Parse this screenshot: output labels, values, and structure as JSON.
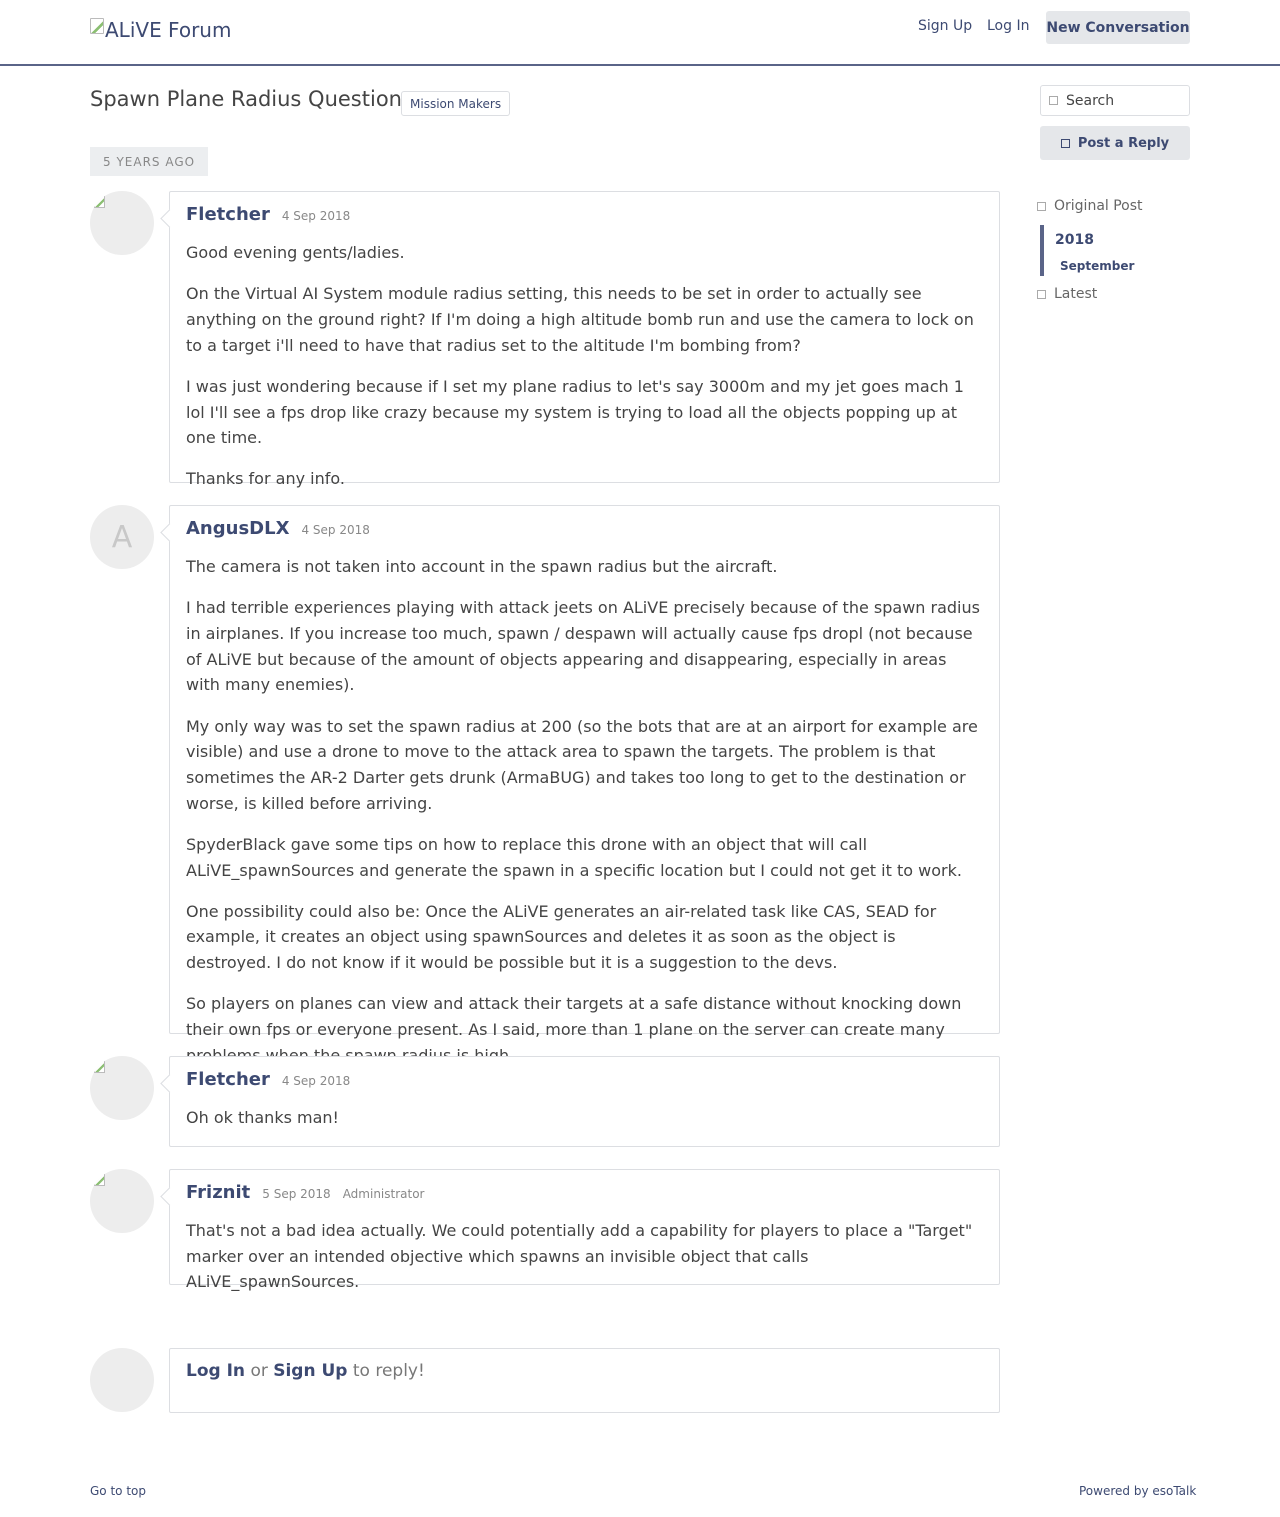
{
  "header": {
    "logo_alt": "ALiVE Forum",
    "sign_up": "Sign Up",
    "log_in": "Log In",
    "new_conversation": "New Conversation"
  },
  "conversation": {
    "title": "Spawn Plane Radius Question",
    "channel": "Mission Makers",
    "time_marker": "5 YEARS AGO"
  },
  "sidebar": {
    "search_placeholder": "Search",
    "post_reply": "Post a Reply",
    "scrubber": {
      "original_post": "Original Post",
      "year": "2018",
      "month": "September",
      "latest": "Latest"
    }
  },
  "posts": [
    {
      "author": "Fletcher",
      "date": "4 Sep 2018",
      "avatar": "broken-image",
      "paragraphs": [
        "Good evening gents/ladies.",
        "On the Virtual AI System module radius setting, this needs to be set in order to actually see anything on the ground right? If I'm doing a high altitude bomb run and use the camera to lock on to a target i'll need to have that radius set to the altitude I'm bombing from?",
        "I was just wondering because if I set my plane radius to let's say 3000m and my jet goes mach 1 lol I'll see a fps drop like crazy because my system is trying to load all the objects popping up at one time.",
        "Thanks for any info."
      ]
    },
    {
      "author": "AngusDLX",
      "date": "4 Sep 2018",
      "avatar_letter": "A",
      "paragraphs": [
        "The camera is not taken into account in the spawn radius but the aircraft.",
        "I had terrible experiences playing with attack jeets on ALiVE precisely because of the spawn radius in airplanes. If you increase too much, spawn / despawn will actually cause fps dropl (not because of ALiVE but because of the amount of objects appearing and disappearing, especially in areas with many enemies).",
        "My only way was to set the spawn radius at 200 (so the bots that are at an airport for example are visible) and use a drone to move to the attack area to spawn the targets. The problem is that sometimes the AR-2 Darter gets drunk (ArmaBUG) and takes too long to get to the destination or worse, is killed before arriving.",
        "SpyderBlack gave some tips on how to replace this drone with an object that will call ALiVE_spawnSources and generate the spawn in a specific location but I could not get it to work.",
        "One possibility could also be: Once the ALiVE generates an air-related task like CAS, SEAD for example, it creates an object using spawnSources and deletes it as soon as the object is destroyed. I do not know if it would be possible but it is a suggestion to the devs.",
        "So players on planes can view and attack their targets at a safe distance without knocking down their own fps or everyone present. As I said, more than 1 plane on the server can create many problems when the spawn radius is high."
      ]
    },
    {
      "author": "Fletcher",
      "date": "4 Sep 2018",
      "avatar": "broken-image",
      "paragraphs": [
        "Oh ok thanks man!"
      ]
    },
    {
      "author": "Friznit",
      "date": "5 Sep 2018",
      "group": "Administrator",
      "avatar": "broken-image",
      "paragraphs": [
        "That's not a bad idea actually. We could potentially add a capability for players to place a \"Target\" marker over an intended objective which spawns an invisible object that calls ALiVE_spawnSources."
      ]
    }
  ],
  "reply_prompt": {
    "log_in": "Log In",
    "or": "or",
    "sign_up": "Sign Up",
    "suffix": "to reply!"
  },
  "footer": {
    "go_to_top": "Go to top",
    "powered_by": "Powered by esoTalk"
  }
}
